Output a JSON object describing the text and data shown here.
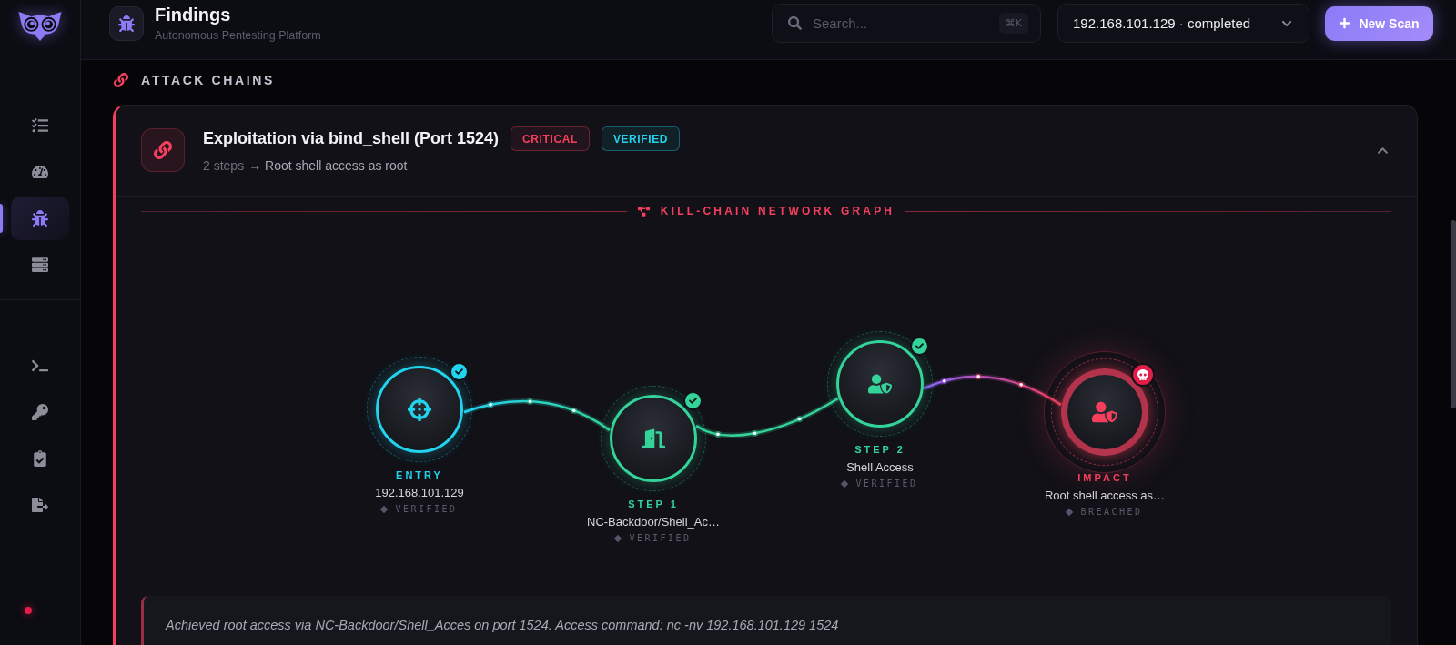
{
  "sidebar": {
    "groups": [
      {
        "items": [
          {
            "selected": false
          },
          {
            "selected": false
          },
          {
            "selected": true
          },
          {
            "selected": false
          }
        ]
      },
      {
        "items": [
          {
            "selected": false
          },
          {
            "selected": false
          },
          {
            "selected": false
          },
          {
            "selected": false
          }
        ]
      }
    ]
  },
  "header": {
    "title": "Findings",
    "subtitle": "Autonomous Pentesting Platform",
    "search": {
      "placeholder": "Search...",
      "shortcut": "⌘K"
    },
    "scan_select": {
      "value": "192.168.101.129 · completed"
    },
    "new_scan_button": {
      "label": "New Scan"
    }
  },
  "section": {
    "heading": "ATTACK CHAINS"
  },
  "chains": [
    {
      "title": "Exploitation via bind_shell (Port 1524)",
      "badges": [
        {
          "label": "CRITICAL",
          "color": "#f43f5e"
        },
        {
          "label": "VERIFIED",
          "color": "#22d3ee"
        }
      ],
      "steps": "2 steps",
      "result": "→ Root shell access as root",
      "expanded": true,
      "graph": {
        "heading": "KILL-CHAIN NETWORK GRAPH",
        "nodes": [
          {
            "kind": "entry",
            "label": "ENTRY",
            "name": "192.168.101.129",
            "status": "VERIFIED"
          },
          {
            "kind": "exploit",
            "label": "STEP 1",
            "name": "NC-Backdoor/Shell_Ac…",
            "status": "VERIFIED"
          },
          {
            "kind": "access",
            "label": "STEP 2",
            "name": "Shell Access",
            "status": "VERIFIED"
          },
          {
            "kind": "impact",
            "label": "IMPACT",
            "name": "Root shell access as…",
            "status": "BREACHED"
          }
        ]
      },
      "note": "Achieved root access via NC-Backdoor/Shell_Acces on port 1524. Access command: nc -nv 192.168.101.129 1524"
    }
  ]
}
